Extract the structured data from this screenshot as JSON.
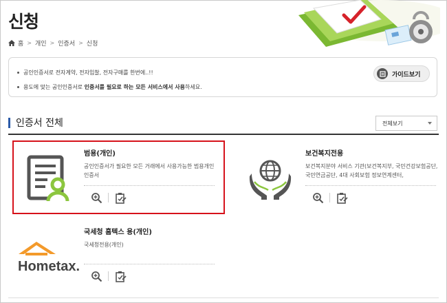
{
  "page": {
    "title": "신청"
  },
  "breadcrumb": {
    "items": [
      "홈",
      "개인",
      "인증서",
      "신청"
    ]
  },
  "notice": {
    "lines": [
      {
        "text": "공인인증서로 전자계약, 전자입찰, 전자구매를 한번에..!!"
      },
      {
        "pre": "용도에 맞는 공인인증서로 ",
        "bold": "인증서를 필요로 하는 모든 서비스에서 사용",
        "post": "하세요."
      }
    ],
    "guide_label": "가이드보기"
  },
  "section": {
    "title": "인증서 전체",
    "filter_value": "전체보기"
  },
  "certificates": [
    {
      "title": "범용(개인)",
      "desc": "공인인증서가 필요한 모든 거래에서 사용가능한 범용개인 인증서",
      "icon": "document-person-icon",
      "highlighted": true
    },
    {
      "title": "보건복지전용",
      "desc": "보건복지분야 서비스 기관(보건복지부, 국민건강보험공단, 국민연금공단, 4대 사회보험 정보연계센터,",
      "icon": "globe-hands-icon",
      "highlighted": false
    },
    {
      "title": "국세청 홈텍스 용(개인)",
      "desc": "국세청전용(개인)",
      "icon": "hometax-logo",
      "logo_text": "Hometax.",
      "highlighted": false
    }
  ],
  "colors": {
    "accent_blue": "#2b5aa8",
    "highlight_red": "#d6111a",
    "cert_icon_green": "#8cc63f",
    "hometax_orange": "#f39a2b"
  }
}
